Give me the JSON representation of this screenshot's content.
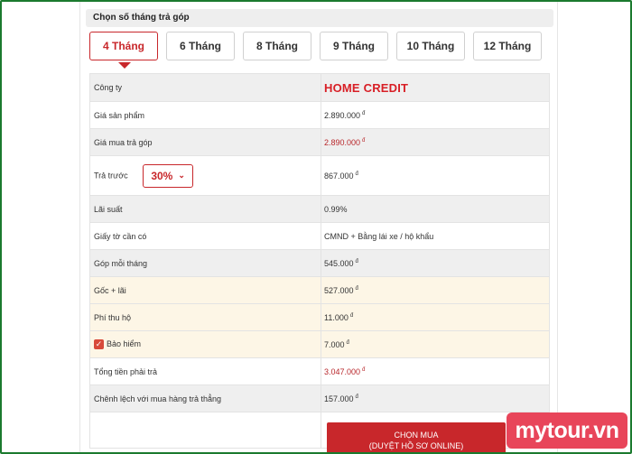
{
  "section": {
    "title": "Chọn số tháng trả góp"
  },
  "tabs": [
    {
      "label": "4 Tháng",
      "active": true
    },
    {
      "label": "6 Tháng",
      "active": false
    },
    {
      "label": "8 Tháng",
      "active": false
    },
    {
      "label": "9 Tháng",
      "active": false
    },
    {
      "label": "10 Tháng",
      "active": false
    },
    {
      "label": "12 Tháng",
      "active": false
    }
  ],
  "table": {
    "company_label": "Công ty",
    "company_logo": "HOME CREDIT",
    "rows": {
      "product_price": {
        "label": "Giá sản phẩm",
        "value": "2.890.000"
      },
      "installment_price": {
        "label": "Giá mua trả góp",
        "value": "2.890.000"
      },
      "prepay": {
        "label": "Trả trước",
        "select_value": "30%",
        "value": "867.000"
      },
      "interest": {
        "label": "Lãi suất",
        "value": "0.99%"
      },
      "documents": {
        "label": "Giấy tờ cần có",
        "value": "CMND + Bằng lái xe / hộ khẩu"
      },
      "monthly": {
        "label": "Góp mỗi tháng",
        "value": "545.000"
      },
      "principal_interest": {
        "label": "Gốc + lãi",
        "value": "527.000"
      },
      "fee": {
        "label": "Phí thu hộ",
        "value": "11.000"
      },
      "insurance": {
        "label": "Bảo hiểm",
        "value": "7.000",
        "checked": true
      },
      "total": {
        "label": "Tổng tiền phải trả",
        "value": "3.047.000"
      },
      "difference": {
        "label": "Chênh lệch với mua hàng trả thẳng",
        "value": "157.000"
      }
    },
    "currency": "đ"
  },
  "buy_button": {
    "line1": "CHỌN MUA",
    "line2": "(DUYỆT HỒ SƠ ONLINE)"
  },
  "watermark": "mytour.vn",
  "colors": {
    "accent": "#c8272b",
    "frame": "#1b7a2e",
    "watermark": "#e8455a"
  }
}
